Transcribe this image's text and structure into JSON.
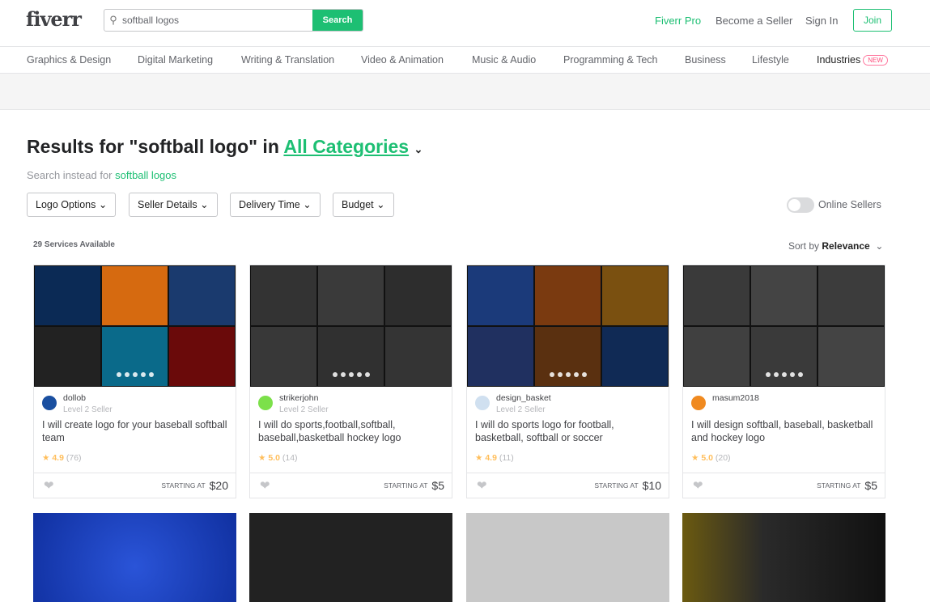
{
  "header": {
    "logo": "fiverr",
    "search_value": "softball logos",
    "search_button": "Search",
    "nav": [
      "Fiverr Pro",
      "Become a Seller",
      "Sign In"
    ],
    "join": "Join"
  },
  "categories": [
    "Graphics & Design",
    "Digital Marketing",
    "Writing & Translation",
    "Video & Animation",
    "Music & Audio",
    "Programming & Tech",
    "Business",
    "Lifestyle",
    "Industries"
  ],
  "new_badge": "NEW",
  "results": {
    "prefix": "Results for \"softball logo\" in ",
    "category": "All Categories",
    "instead_prefix": "Search instead for ",
    "instead_link": "softball logos"
  },
  "filters": [
    "Logo Options",
    "Seller Details",
    "Delivery Time",
    "Budget"
  ],
  "online_sellers": "Online Sellers",
  "count": "29 Services Available",
  "sort": {
    "label": "Sort by",
    "value": "Relevance"
  },
  "gigs": [
    {
      "seller": "dollob",
      "level": "Level 2 Seller",
      "title": "I will create logo for your baseball softball team",
      "rating": "4.9",
      "reviews": "(76)",
      "starting": "STARTING AT",
      "price": "$20"
    },
    {
      "seller": "strikerjohn",
      "level": "Level 2 Seller",
      "title": "I will do sports,football,softball, baseball,basketball hockey logo",
      "rating": "5.0",
      "reviews": "(14)",
      "starting": "STARTING AT",
      "price": "$5"
    },
    {
      "seller": "design_basket",
      "level": "Level 2 Seller",
      "title": "I will do sports logo for football, basketball, softball or soccer",
      "rating": "4.9",
      "reviews": "(11)",
      "starting": "STARTING AT",
      "price": "$10"
    },
    {
      "seller": "masum2018",
      "level": "",
      "title": "I will design softball, baseball, basketball and hockey logo",
      "rating": "5.0",
      "reviews": "(20)",
      "starting": "STARTING AT",
      "price": "$5"
    }
  ],
  "colors": {
    "brand": "#1dbf73",
    "star": "#ffbe5b"
  }
}
